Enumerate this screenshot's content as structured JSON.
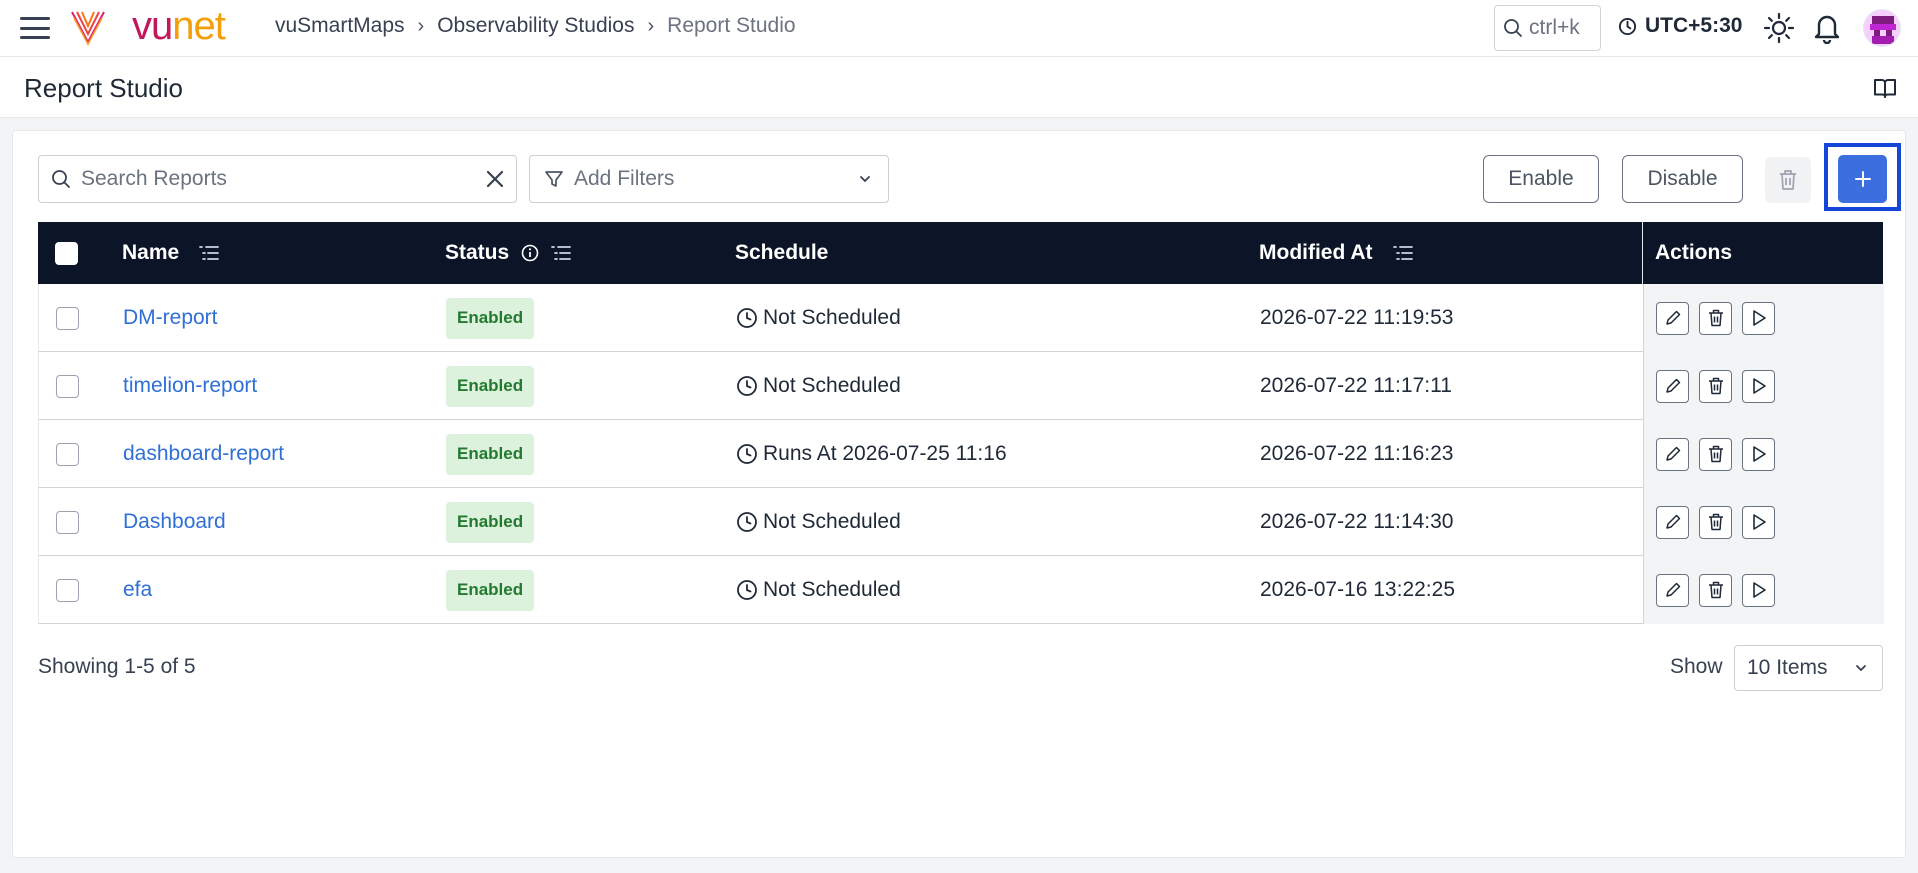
{
  "topbar": {
    "logo_vu": "vu",
    "logo_net": "net",
    "breadcrumbs": [
      "vuSmartMaps",
      "Observability Studios",
      "Report Studio"
    ],
    "search_shortcut": "ctrl+k",
    "timezone": "UTC+5:30"
  },
  "page": {
    "title": "Report Studio"
  },
  "toolbar": {
    "search_placeholder": "Search Reports",
    "filters_label": "Add Filters",
    "enable_label": "Enable",
    "disable_label": "Disable",
    "add_label": "+"
  },
  "table": {
    "columns": {
      "name": "Name",
      "status": "Status",
      "schedule": "Schedule",
      "modified": "Modified At",
      "actions": "Actions"
    },
    "rows": [
      {
        "name": "DM-report",
        "status": "Enabled",
        "schedule": "Not Scheduled",
        "modified": "2026-07-22 11:19:53"
      },
      {
        "name": "timelion-report",
        "status": "Enabled",
        "schedule": "Not Scheduled",
        "modified": "2026-07-22 11:17:11"
      },
      {
        "name": "dashboard-report",
        "status": "Enabled",
        "schedule": "Runs At 2026-07-25 11:16",
        "modified": "2026-07-22 11:16:23"
      },
      {
        "name": "Dashboard",
        "status": "Enabled",
        "schedule": "Not Scheduled",
        "modified": "2026-07-22 11:14:30"
      },
      {
        "name": "efa",
        "status": "Enabled",
        "schedule": "Not Scheduled",
        "modified": "2026-07-16 13:22:25"
      }
    ]
  },
  "pagination": {
    "showing": "Showing 1-5 of 5",
    "show_label": "Show",
    "page_size": "10 Items"
  },
  "colors": {
    "header_bg": "#0c1427",
    "primary": "#3b6fe0",
    "link": "#2f6fd6",
    "badge_bg": "#dcf2dd",
    "badge_text": "#237a2f",
    "focus_outline": "#1447d8"
  }
}
